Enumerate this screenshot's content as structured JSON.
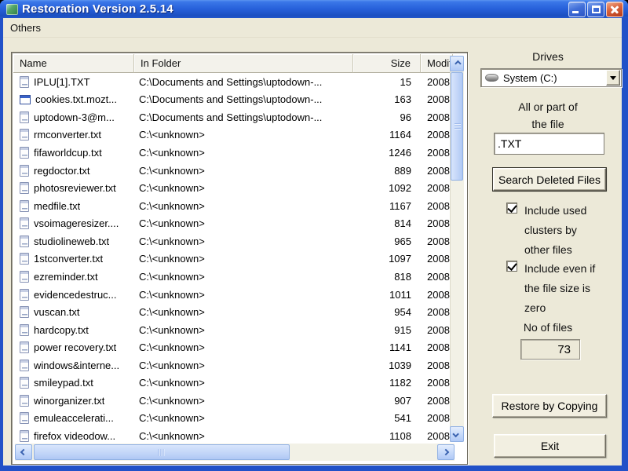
{
  "window": {
    "title": "Restoration Version 2.5.14"
  },
  "menu": {
    "items": [
      {
        "label": "Others"
      }
    ]
  },
  "list": {
    "columns": [
      {
        "label": "Name"
      },
      {
        "label": "In Folder"
      },
      {
        "label": "Size"
      },
      {
        "label": "Modified"
      }
    ],
    "rows": [
      {
        "icon": "notepad",
        "name": "IPLU[1].TXT",
        "folder": "C:\\Documents and Settings\\uptodown-...",
        "size": "15",
        "modified": "2008"
      },
      {
        "icon": "window",
        "name": "cookies.txt.mozt...",
        "folder": "C:\\Documents and Settings\\uptodown-...",
        "size": "163",
        "modified": "2008"
      },
      {
        "icon": "notepad",
        "name": "uptodown-3@m...",
        "folder": "C:\\Documents and Settings\\uptodown-...",
        "size": "96",
        "modified": "2008"
      },
      {
        "icon": "notepad",
        "name": "rmconverter.txt",
        "folder": "C:\\<unknown>",
        "size": "1164",
        "modified": "2008"
      },
      {
        "icon": "notepad",
        "name": "fifaworldcup.txt",
        "folder": "C:\\<unknown>",
        "size": "1246",
        "modified": "2008"
      },
      {
        "icon": "notepad",
        "name": "regdoctor.txt",
        "folder": "C:\\<unknown>",
        "size": "889",
        "modified": "2008"
      },
      {
        "icon": "notepad",
        "name": "photosreviewer.txt",
        "folder": "C:\\<unknown>",
        "size": "1092",
        "modified": "2008"
      },
      {
        "icon": "notepad",
        "name": "medfile.txt",
        "folder": "C:\\<unknown>",
        "size": "1167",
        "modified": "2008"
      },
      {
        "icon": "notepad",
        "name": "vsoimageresizer....",
        "folder": "C:\\<unknown>",
        "size": "814",
        "modified": "2008"
      },
      {
        "icon": "notepad",
        "name": "studiolineweb.txt",
        "folder": "C:\\<unknown>",
        "size": "965",
        "modified": "2008"
      },
      {
        "icon": "notepad",
        "name": "1stconverter.txt",
        "folder": "C:\\<unknown>",
        "size": "1097",
        "modified": "2008"
      },
      {
        "icon": "notepad",
        "name": "ezreminder.txt",
        "folder": "C:\\<unknown>",
        "size": "818",
        "modified": "2008"
      },
      {
        "icon": "notepad",
        "name": "evidencedestruc...",
        "folder": "C:\\<unknown>",
        "size": "1011",
        "modified": "2008"
      },
      {
        "icon": "notepad",
        "name": "vuscan.txt",
        "folder": "C:\\<unknown>",
        "size": "954",
        "modified": "2008"
      },
      {
        "icon": "notepad",
        "name": "hardcopy.txt",
        "folder": "C:\\<unknown>",
        "size": "915",
        "modified": "2008"
      },
      {
        "icon": "notepad",
        "name": "power recovery.txt",
        "folder": "C:\\<unknown>",
        "size": "1141",
        "modified": "2008"
      },
      {
        "icon": "notepad",
        "name": "windows&interne...",
        "folder": "C:\\<unknown>",
        "size": "1039",
        "modified": "2008"
      },
      {
        "icon": "notepad",
        "name": "smileypad.txt",
        "folder": "C:\\<unknown>",
        "size": "1182",
        "modified": "2008"
      },
      {
        "icon": "notepad",
        "name": "winorganizer.txt",
        "folder": "C:\\<unknown>",
        "size": "907",
        "modified": "2008"
      },
      {
        "icon": "notepad",
        "name": "emuleaccelerati...",
        "folder": "C:\\<unknown>",
        "size": "541",
        "modified": "2008"
      },
      {
        "icon": "notepad",
        "name": "firefox videodow...",
        "folder": "C:\\<unknown>",
        "size": "1108",
        "modified": "2008"
      }
    ]
  },
  "panel": {
    "drives_label": "Drives",
    "drive_selected": "System (C:)",
    "file_label_line1": "All or part of",
    "file_label_line2": "the file",
    "file_input_value": ".TXT",
    "search_button": "Search Deleted Files",
    "checkbox_used_clusters": {
      "checked": true,
      "lines": [
        "Include used",
        "clusters by",
        "other files"
      ]
    },
    "checkbox_zero_size": {
      "checked": true,
      "lines": [
        "Include even if",
        "the file size is",
        "zero"
      ]
    },
    "no_of_files_label": "No of files",
    "no_of_files_value": "73",
    "restore_button": "Restore by Copying",
    "exit_button": "Exit"
  },
  "colors": {
    "window_border": "#2151C8",
    "titlebar_hi": "#5B95F0",
    "titlebar_start": "#3A77E8",
    "titlebar_mid": "#2760DA",
    "titlebar_end": "#1B4FC0",
    "close_button": "#D8623C",
    "client_bg": "#ECE9D8",
    "list_bg": "#FFFFFF",
    "header_bg": "#F3F2EB",
    "button_face": "#F2EFE1",
    "scrollbar_thumb": "#C3D6F8",
    "scrollbar_border": "#8FB0E4"
  }
}
